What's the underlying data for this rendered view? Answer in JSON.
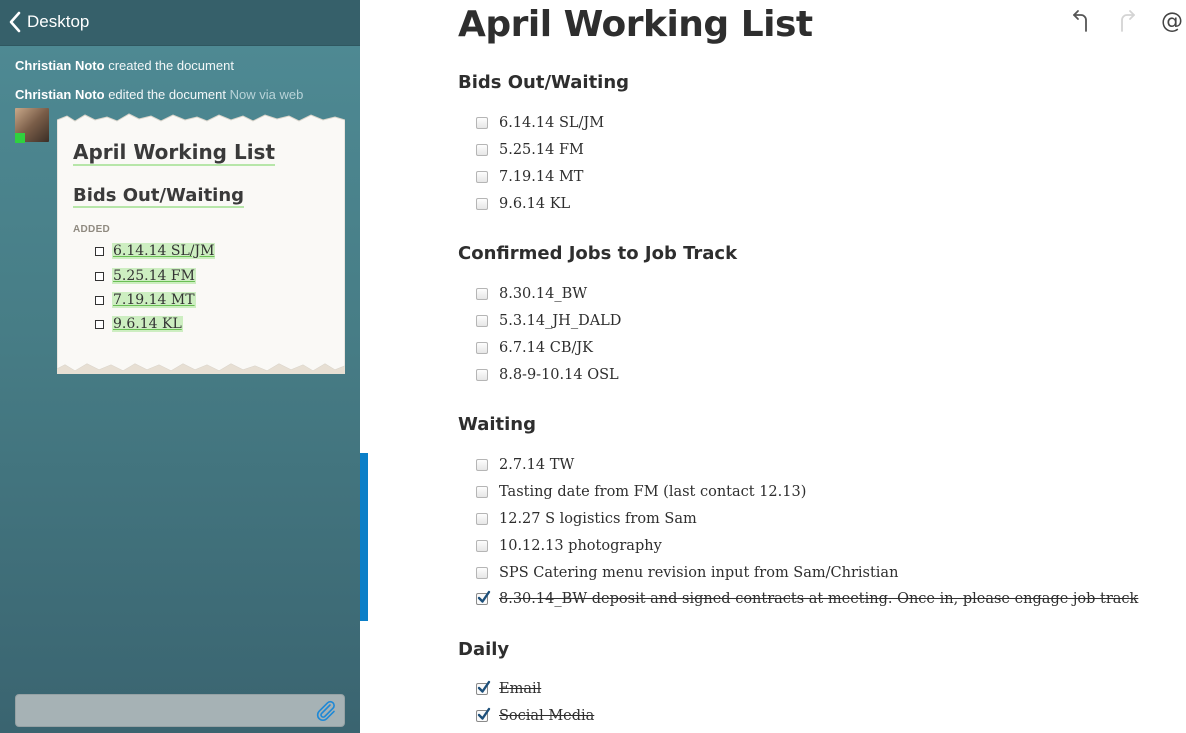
{
  "sidebar": {
    "back_label": "Desktop",
    "activity": [
      {
        "user": "Christian Noto",
        "action": "created the document",
        "meta": ""
      },
      {
        "user": "Christian Noto",
        "action": "edited the document",
        "meta": "Now via web"
      }
    ],
    "preview": {
      "title": "April Working List",
      "heading": "Bids Out/Waiting",
      "added_label": "ADDED",
      "items": [
        "6.14.14 SL/JM",
        "5.25.14 FM",
        "7.19.14 MT",
        "9.6.14 KL"
      ]
    },
    "comment_placeholder": "",
    "colors": {
      "status_online": "#2fd13e",
      "added_highlight": "#cdeec1"
    }
  },
  "toolbar": {
    "undo_icon": "undo-icon",
    "redo_icon": "redo-icon",
    "mention_label": "@"
  },
  "document": {
    "title": "April Working List",
    "sections": [
      {
        "heading": "Bids Out/Waiting",
        "items": [
          {
            "text": "6.14.14 SL/JM",
            "checked": false
          },
          {
            "text": "5.25.14 FM",
            "checked": false
          },
          {
            "text": "7.19.14 MT",
            "checked": false
          },
          {
            "text": "9.6.14 KL",
            "checked": false
          }
        ]
      },
      {
        "heading": "Confirmed Jobs to Job Track",
        "items": [
          {
            "text": "8.30.14_BW",
            "checked": false
          },
          {
            "text": "5.3.14_JH_DALD",
            "checked": false
          },
          {
            "text": "6.7.14 CB/JK",
            "checked": false
          },
          {
            "text": "8.8-9-10.14 OSL",
            "checked": false
          }
        ]
      },
      {
        "heading": "Waiting",
        "items": [
          {
            "text": "2.7.14 TW",
            "checked": false
          },
          {
            "text": "Tasting date from FM (last contact 12.13)",
            "checked": false
          },
          {
            "text": "12.27 S logistics from Sam",
            "checked": false
          },
          {
            "text": "10.12.13 photography",
            "checked": false
          },
          {
            "text": "SPS Catering menu revision input from Sam/Christian",
            "checked": false
          },
          {
            "text": "8.30.14_BW deposit and signed contracts at meeting. Once in, please engage job track",
            "checked": true
          }
        ]
      },
      {
        "heading": "Daily",
        "items": [
          {
            "text": "Email",
            "checked": true
          },
          {
            "text": "Social Media",
            "checked": true
          }
        ]
      }
    ]
  }
}
